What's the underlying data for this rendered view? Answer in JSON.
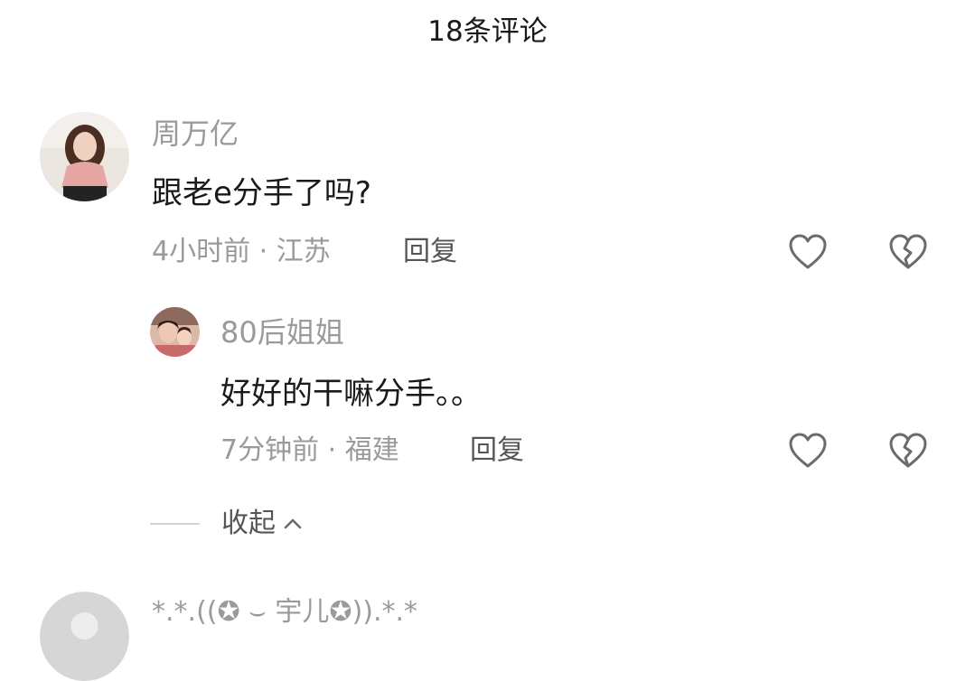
{
  "header": {
    "title": "18条评论"
  },
  "comments": [
    {
      "user_name": "周万亿",
      "text": "跟老e分手了吗?",
      "meta": "4小时前 · 江苏",
      "reply_label": "回复"
    }
  ],
  "reply": {
    "user_name": "80后姐姐",
    "text": "好好的干嘛分手。。",
    "meta": "7分钟前 · 福建",
    "reply_label": "回复"
  },
  "collapse": {
    "label": "收起"
  },
  "next_comment": {
    "user_name": "*.*.((✪ ⌣ 宇儿✪)).*.*"
  },
  "colors": {
    "name_gray": "#9a9a9a",
    "text_dark": "#1a1a1a",
    "icon_gray": "#6b6b6b"
  },
  "icons": {
    "like": "heart-outline-icon",
    "dislike": "broken-heart-icon",
    "collapse": "chevron-up-icon"
  }
}
